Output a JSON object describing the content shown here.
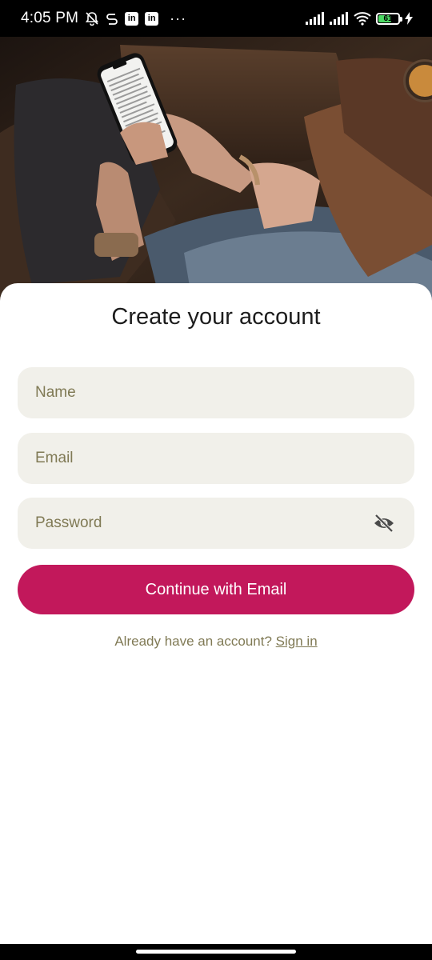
{
  "status_bar": {
    "time": "4:05 PM",
    "battery": "61",
    "notification_icons": [
      "mute-bell-icon",
      "sync-icon",
      "linkedin-icon",
      "linkedin-icon"
    ],
    "overflow": "···"
  },
  "linkedin_glyph": "in",
  "form": {
    "title": "Create your account",
    "name_placeholder": "Name",
    "email_placeholder": "Email",
    "password_placeholder": "Password",
    "submit_label": "Continue with Email",
    "signin_prompt": "Already have an account?",
    "signin_link": "Sign in"
  },
  "colors": {
    "primary": "#c2185b",
    "field_bg": "#f1f0ea",
    "muted_text": "#807a55"
  }
}
